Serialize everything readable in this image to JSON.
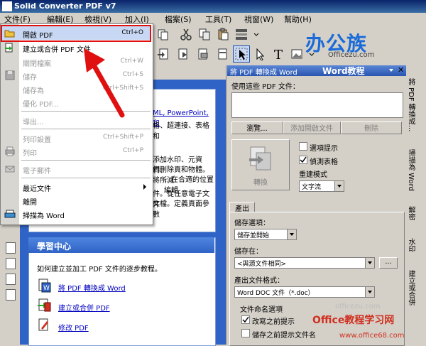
{
  "window": {
    "title": "Solid Converter PDF v7"
  },
  "menubar": {
    "items": [
      "文件(F)",
      "編輯(E)",
      "檢視(V)",
      "加入(I)",
      "檔案(S)",
      "工具(T)",
      "視窗(W)",
      "幫助(H)"
    ]
  },
  "logo": {
    "text": "办公族",
    "sub": "Officezu.com"
  },
  "dropdown": {
    "items": [
      {
        "label": "開啟 PDF",
        "shortcut": "Ctrl+O",
        "enabled": true
      },
      {
        "label": "建立或合併 PDF 文件",
        "shortcut": "",
        "enabled": true
      },
      {
        "label": "關閉檔案",
        "shortcut": "Ctrl+W",
        "enabled": false
      },
      {
        "label": "儲存",
        "shortcut": "Ctrl+S",
        "enabled": false
      },
      {
        "label": "儲存為",
        "shortcut": "Ctrl+Shift+S",
        "enabled": false
      },
      {
        "label": "優化 PDF...",
        "shortcut": "",
        "enabled": false
      },
      {
        "label": "導出...",
        "shortcut": "",
        "enabled": false
      },
      {
        "label": "列印設置",
        "shortcut": "Ctrl+Shift+P",
        "enabled": false
      },
      {
        "label": "列印",
        "shortcut": "Ctrl+P",
        "enabled": false
      },
      {
        "label": "電子郵件",
        "shortcut": "",
        "enabled": false
      },
      {
        "label": "最近文件",
        "shortcut": "",
        "enabled": true
      },
      {
        "label": "離開",
        "shortcut": "",
        "enabled": true
      },
      {
        "label": "掃描為 Word",
        "shortcut": "",
        "enabled": true
      }
    ]
  },
  "docpane": {
    "partial_text_1": "ML, PowerPoint, 和",
    "partial_text_2": "格、超連接、表格和",
    "partial_text_3": "添加水印、元資料、",
    "partial_text_4": "們刪除頁和物體。將所減",
    "partial_text_5": "、在合適的位置編輯",
    "partial_text_6": "件。從任意電子文件",
    "partial_text_7": "文檔。定義頁面參數",
    "learn_title": "學習中心",
    "learn_desc": "如何建立並加工 PDF 文件的逐步教程。",
    "links": [
      "將 PDF 轉換成 Word",
      "建立或合併 PDF",
      "修改 PDF"
    ]
  },
  "rpanel": {
    "title": "將 PDF 轉換成 Word",
    "title_overlay": "Word教程",
    "use_label": "使用這些 PDF 文件：",
    "browse": "瀏覽...",
    "add_open": "添加開啟文件",
    "remove": "刪除",
    "convert": "轉換",
    "opt_hint": "選項提示",
    "opt_detect": "偵測表格",
    "rebuild_label": "重建模式",
    "rebuild_value": "文字流",
    "output_tab": "產出",
    "save_opt_label": "儲存選項：",
    "save_opt_value": "儲存並開始",
    "save_in_label": "儲存在：",
    "save_in_value": "<與源文件相同>",
    "browse_small": "...",
    "format_label": "產出文件格式：",
    "format_value": "Word DOC 文件（*.doc）",
    "naming_label": "文件命名選項",
    "naming_1": "改寫之前提示",
    "naming_2": "儲存之前提示文件名"
  },
  "vtabs": [
    "將 PDF 轉換成...",
    "掃描為 Word",
    "解密",
    "水印",
    "建立或合併"
  ],
  "watermark": {
    "main": "Office教程学习网",
    "url": "www.office68.com",
    "mid": "officezu.com"
  }
}
